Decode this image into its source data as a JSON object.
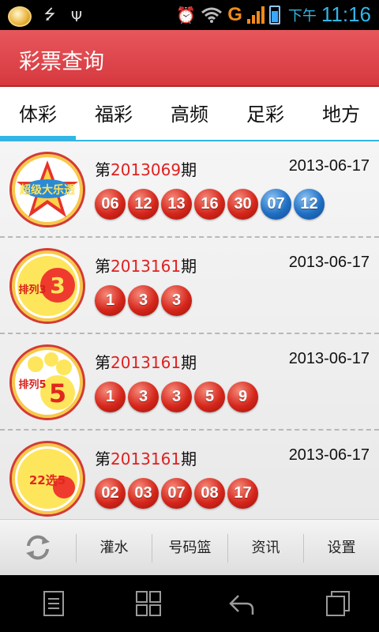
{
  "status_bar": {
    "icons": [
      "app-notification-icon",
      "usb-icon",
      "usb-debug-icon",
      "alarm-icon",
      "wifi-icon",
      "network-g-icon",
      "signal-icon",
      "battery-charging-icon"
    ],
    "network_type": "G",
    "ampm": "下午",
    "time": "11:16"
  },
  "header": {
    "title": "彩票查询"
  },
  "tabs": [
    {
      "label": "体彩",
      "selected": true
    },
    {
      "label": "福彩",
      "selected": false
    },
    {
      "label": "高频",
      "selected": false
    },
    {
      "label": "足彩",
      "selected": false
    },
    {
      "label": "地方",
      "selected": false
    }
  ],
  "accent_color": "#33b5e5",
  "lotteries": [
    {
      "logo": "超级大乐透",
      "prefix": "第",
      "issue": "2013069",
      "suffix": "期",
      "date": "2013-06-17",
      "red_balls": [
        "06",
        "12",
        "13",
        "16",
        "30"
      ],
      "blue_balls": [
        "07",
        "12"
      ]
    },
    {
      "logo": "排列3",
      "prefix": "第",
      "issue": "2013161",
      "suffix": "期",
      "date": "2013-06-17",
      "red_balls": [
        "1",
        "3",
        "3"
      ],
      "blue_balls": []
    },
    {
      "logo": "排列5",
      "prefix": "第",
      "issue": "2013161",
      "suffix": "期",
      "date": "2013-06-17",
      "red_balls": [
        "1",
        "3",
        "3",
        "5",
        "9"
      ],
      "blue_balls": []
    },
    {
      "logo": "22选5",
      "prefix": "第",
      "issue": "2013161",
      "suffix": "期",
      "date": "2013-06-17",
      "red_balls": [
        "02",
        "03",
        "07",
        "08",
        "17"
      ],
      "blue_balls": []
    }
  ],
  "toolbar": {
    "refresh_icon": "refresh-icon",
    "items": [
      "灌水",
      "号码篮",
      "资讯",
      "设置"
    ]
  },
  "nav_bar": {
    "icons": [
      "menu-icon",
      "home-icon",
      "back-icon",
      "recent-apps-icon"
    ]
  }
}
